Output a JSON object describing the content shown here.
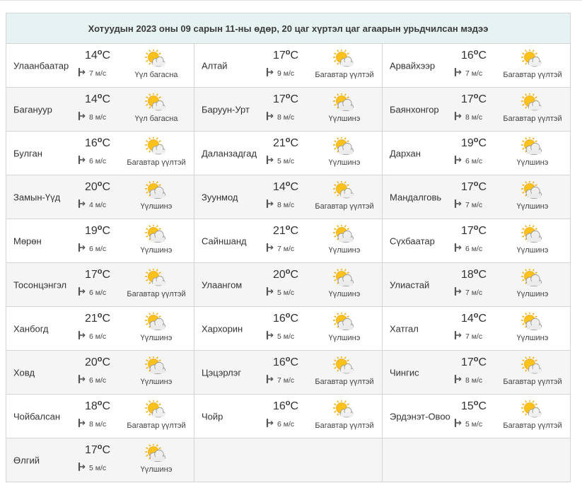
{
  "title": "Хотуудын 2023 оны 09 сарын 11-ны өдөр, 20 цаг хүртэл цаг агаарын урьдчилсан мэдээ",
  "deg_unit": "o",
  "temp_unit": "C",
  "cities": [
    {
      "name": "Улаанбаатар",
      "temp": "14",
      "wind": "7 м/с",
      "condition": "Үүл багасна",
      "icon": "sun-cloud-icon"
    },
    {
      "name": "Алтай",
      "temp": "17",
      "wind": "9 м/с",
      "condition": "Багавтар үүлтэй",
      "icon": "sun-cloud-icon"
    },
    {
      "name": "Арвайхээр",
      "temp": "16",
      "wind": "7 м/с",
      "condition": "Багавтар үүлтэй",
      "icon": "sun-cloud-icon"
    },
    {
      "name": "Баганууp",
      "temp": "14",
      "wind": "8 м/с",
      "condition": "Үүл багасна",
      "icon": "sun-cloud-icon"
    },
    {
      "name": "Баруун-Урт",
      "temp": "17",
      "wind": "8 м/с",
      "condition": "Үүлшинэ",
      "icon": "cloud-sun-icon"
    },
    {
      "name": "Баянхонгор",
      "temp": "17",
      "wind": "8 м/с",
      "condition": "Багавтар үүлтэй",
      "icon": "sun-cloud-icon"
    },
    {
      "name": "Булган",
      "temp": "16",
      "wind": "6 м/с",
      "condition": "Багавтар үүлтэй",
      "icon": "sun-cloud-icon"
    },
    {
      "name": "Даланзадгад",
      "temp": "21",
      "wind": "5 м/с",
      "condition": "Үүлшинэ",
      "icon": "cloud-sun-icon"
    },
    {
      "name": "Дархан",
      "temp": "19",
      "wind": "6 м/с",
      "condition": "Үүлшинэ",
      "icon": "cloud-sun-icon"
    },
    {
      "name": "Замын-Үүд",
      "temp": "20",
      "wind": "4 м/с",
      "condition": "Үүлшинэ",
      "icon": "cloud-sun-icon"
    },
    {
      "name": "Зуунмод",
      "temp": "14",
      "wind": "8 м/с",
      "condition": "Багавтар үүлтэй",
      "icon": "sun-cloud-icon"
    },
    {
      "name": "Мандалговь",
      "temp": "17",
      "wind": "7 м/с",
      "condition": "Үүлшинэ",
      "icon": "cloud-sun-icon"
    },
    {
      "name": "Мөрөн",
      "temp": "19",
      "wind": "6 м/с",
      "condition": "Үүлшинэ",
      "icon": "cloud-sun-icon"
    },
    {
      "name": "Сайншанд",
      "temp": "21",
      "wind": "7 м/с",
      "condition": "Үүлшинэ",
      "icon": "cloud-sun-icon"
    },
    {
      "name": "Сүхбаатар",
      "temp": "17",
      "wind": "6 м/с",
      "condition": "Үүлшинэ",
      "icon": "cloud-sun-icon"
    },
    {
      "name": "Тосонцэнгэл",
      "temp": "17",
      "wind": "6 м/с",
      "condition": "Багавтар үүлтэй",
      "icon": "sun-cloud-icon"
    },
    {
      "name": "Улаангом",
      "temp": "20",
      "wind": "5 м/с",
      "condition": "Үүлшинэ",
      "icon": "cloud-sun-icon"
    },
    {
      "name": "Улиастай",
      "temp": "18",
      "wind": "7 м/с",
      "condition": "Үүлшинэ",
      "icon": "cloud-sun-icon"
    },
    {
      "name": "Ханбогд",
      "temp": "21",
      "wind": "6 м/с",
      "condition": "Үүлшинэ",
      "icon": "cloud-sun-icon"
    },
    {
      "name": "Хархорин",
      "temp": "16",
      "wind": "5 м/с",
      "condition": "Үүлшинэ",
      "icon": "cloud-sun-icon"
    },
    {
      "name": "Хатгал",
      "temp": "14",
      "wind": "7 м/с",
      "condition": "Үүлшинэ",
      "icon": "cloud-sun-icon"
    },
    {
      "name": "Ховд",
      "temp": "20",
      "wind": "6 м/с",
      "condition": "Үүлшинэ",
      "icon": "cloud-sun-icon"
    },
    {
      "name": "Цэцэрлэг",
      "temp": "16",
      "wind": "7 м/с",
      "condition": "Багавтар үүлтэй",
      "icon": "sun-cloud-icon"
    },
    {
      "name": "Чингис",
      "temp": "17",
      "wind": "8 м/с",
      "condition": "Багавтар үүлтэй",
      "icon": "sun-cloud-icon"
    },
    {
      "name": "Чойбалсан",
      "temp": "18",
      "wind": "8 м/с",
      "condition": "Багавтар үүлтэй",
      "icon": "sun-cloud-icon"
    },
    {
      "name": "Чойр",
      "temp": "16",
      "wind": "6 м/с",
      "condition": "Багавтар үүлтэй",
      "icon": "sun-cloud-icon"
    },
    {
      "name": "Эрдэнэт-Овоо",
      "temp": "15",
      "wind": "5 м/с",
      "condition": "Багавтар үүлтэй",
      "icon": "sun-cloud-icon"
    },
    {
      "name": "Өлгий",
      "temp": "17",
      "wind": "5 м/с",
      "condition": "Үүлшинэ",
      "icon": "cloud-sun-icon"
    }
  ]
}
